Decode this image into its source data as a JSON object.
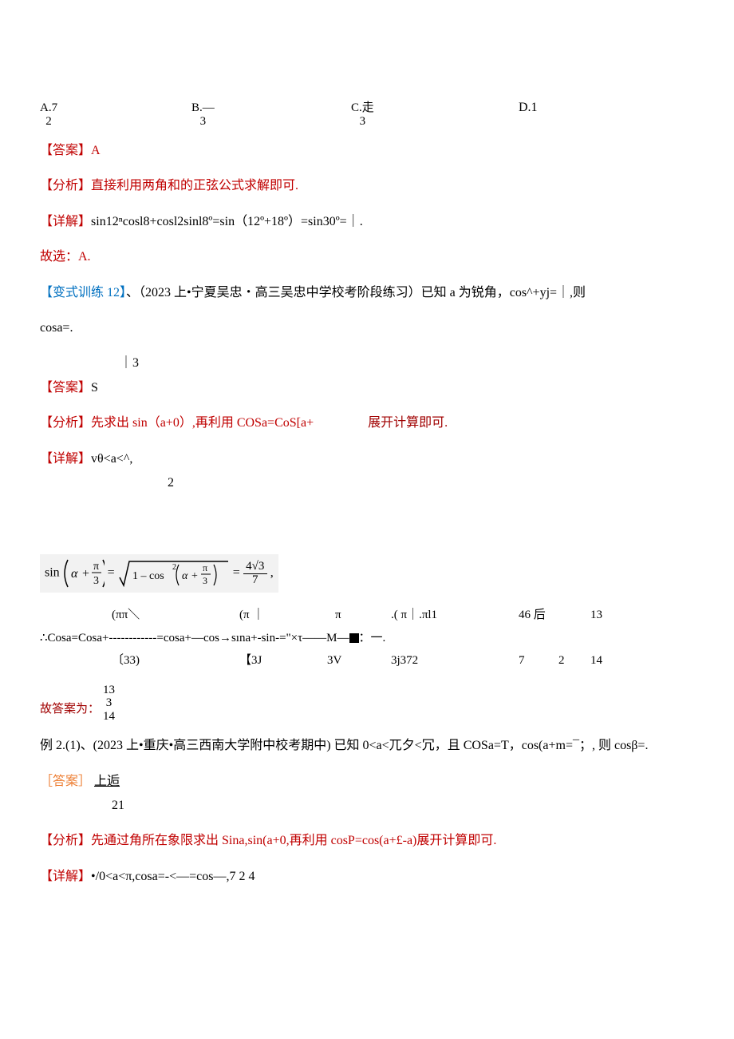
{
  "options": {
    "a_label": "A.7",
    "a_sub": "2",
    "b_label": "B.—",
    "b_sub": "3",
    "c_label": "C.走",
    "c_sub": "3",
    "d_label": "D.1"
  },
  "ans1_label": "【答案】",
  "ans1_val": "A",
  "analysis1_label": "【分析】",
  "analysis1_text": "直接利用两角和的正弦公式求解即可.",
  "detail1_label": "【详解】",
  "detail1_text": "sin12ⁿcosl8+cosl2sinl8º=sin（12º+18º）=sin30º=｜.",
  "choice1": "故选：A.",
  "var12_label": "【变式训练 12】",
  "var12_text1": "、（2023 上•宁夏吴忠・高三吴忠中学校考阶段练习）已知 a 为锐角，cos^+yj=｜,则",
  "var12_text2": "cosa=.",
  "ans2_pre": "｜3",
  "ans2_label": "【答案】",
  "ans2_val": "S",
  "analysis2_label": "【分析】",
  "analysis2_text1": "先求出 sin（a+0）,再利用 COSa=CoS[a+",
  "analysis2_text2": "展开计算即可.",
  "detail2_label": "【详解】",
  "detail2_text": "vθ<a<^,",
  "detail2_sub": "2",
  "formula_img": {
    "sin_label": "sin",
    "alpha": "α",
    "plus": "+",
    "pi_over_3": "π",
    "pi_over_3_den": "3",
    "eq": "=",
    "one_minus": "1 – cos",
    "sq": "2",
    "rhs_num": "4√3",
    "rhs_den": "7"
  },
  "cosa_line": {
    "row1_a": "(ππ＼",
    "row1_b": "(π ｜",
    "row1_c": "π",
    "row1_d": ".(    π｜.πl1",
    "row1_e": "46 后",
    "row1_f": "13",
    "row2": "∴Cosa=Cosa+------------=cosa+—cos→sına+-sin-=\"×τ——M—",
    "row2_tail": "：一.",
    "row3_a": "〔33)",
    "row3_b": "【3J",
    "row3_c": "3V",
    "row3_d": "3j372",
    "row3_e": "7",
    "row3_f": "2",
    "row3_g": "14"
  },
  "final_ans1_label": "故答案为：",
  "final_ans1_top": "13",
  "final_ans1_mid": "3",
  "final_ans1_bot": "14",
  "ex2_text": "例 2.(1)、(2023 上•重庆•高三西南大学附中校考期中) 已知 0<a<兀夕<冗，且 COSa=T，cos(a+m=¯；, 则 cosβ=.",
  "ans3_label": "［答案］",
  "ans3_val": "上逅",
  "ans3_sub": "21",
  "analysis3_label": "【分析】",
  "analysis3_text": "先通过角所在象限求出 Sina,sin(a+0,再利用 cosP=cos(a+£-a)展开计算即可.",
  "detail3_label": "【详解】",
  "detail3_text": "•/0<a<π,cosa=-<—=cos—,7       2          4"
}
